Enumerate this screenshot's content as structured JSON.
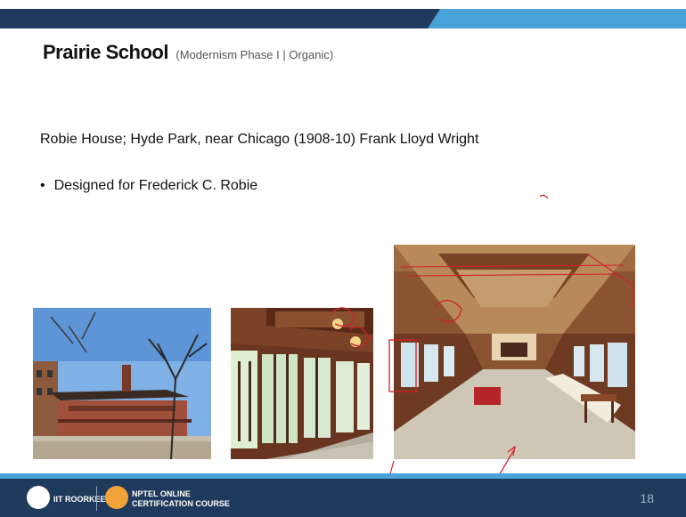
{
  "slide": {
    "title": "Prairie School",
    "subtitle": "(Modernism Phase I | Organic)",
    "heading": "Robie House; Hyde Park, near Chicago (1908-10) Frank Lloyd Wright",
    "bullet": "Designed for Frederick C. Robie",
    "page_number": "18"
  },
  "footer": {
    "institution": "IIT ROORKEE",
    "course_line1": "NPTEL ONLINE",
    "course_line2": "CERTIFICATION COURSE"
  },
  "colors": {
    "navy": "#1f3a5c",
    "accent_blue": "#4aa3d8",
    "annotation_red": "#d0212a"
  }
}
